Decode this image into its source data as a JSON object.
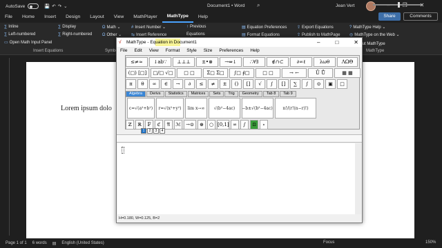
{
  "titlebar": {
    "autosave": "AutoSave",
    "autosave_state": "Off",
    "doc_title": "Document1 • Word",
    "user": "Jean Vert"
  },
  "tabs": [
    "File",
    "Home",
    "Insert",
    "Design",
    "Layout",
    "View",
    "MathPlayer",
    "MathType",
    "Help"
  ],
  "active_tab": "MathType",
  "share": "Share",
  "comments": "Comments",
  "ribbon": {
    "insert_equations": [
      "Inline",
      "Left-numbered",
      "Open Math Input Panel"
    ],
    "display": [
      "Display",
      "Right-numbered"
    ],
    "symbols": [
      "Math",
      "Other"
    ],
    "group_insert_equations": "Insert Equations",
    "group_symbols": "Symbo",
    "insert_number": "Insert Number",
    "insert_reference": "Insert Reference",
    "previous": "Previous",
    "equations": "Equations",
    "equation_prefs": "Equation Preferences",
    "format_equations": "Format Equations",
    "export_equations": "Export Equations",
    "publish_mathpage": "Publish to MathPage",
    "mathtype_help": "MathType Help",
    "mathtype_web": "MathType on the Web",
    "about": "About MathType",
    "group_mathtype": "MathType"
  },
  "document": {
    "text": "Lorem ipsum dolo"
  },
  "status": {
    "page": "Page 1 of 1",
    "words": "6 words",
    "language": "English (United States)",
    "focus": "Focus",
    "zoom": "150%"
  },
  "mathtype": {
    "title": "MathType - Equation in Document1",
    "menu": [
      "File",
      "Edit",
      "View",
      "Format",
      "Style",
      "Size",
      "Preferences",
      "Help"
    ],
    "row1": [
      "≤≠≈",
      "↓ab∵",
      "⊥⊥⊥",
      "±•⊗",
      "→⇔↓",
      "∴∀∃",
      "∉∩⊂",
      "∂∞ℓ",
      "λωθ",
      "ΛΩΘ"
    ],
    "row2": [
      "(□) [□]",
      "□/□ √□",
      "□ □",
      "Σ□ Σ□",
      "∫□ ∮□",
      "□ □",
      "→ ←",
      "Ū Ů",
      "▦ ▦"
    ],
    "row3": [
      "π",
      "θ",
      "∞",
      "∈",
      "→",
      "∂",
      "≤",
      "≠",
      "±",
      "()",
      "[]",
      "√",
      "∫",
      "[]",
      "∑",
      "∫",
      "⊙",
      "▣",
      "□"
    ],
    "tabs": [
      "Algebra",
      "Derivs",
      "Statistics",
      "Matrices",
      "Sets",
      "Trig",
      "Geometry",
      "Tab 8",
      "Tab 9"
    ],
    "active_tab": "Algebra",
    "templates": [
      "c=√(a²+b²)",
      "r=√(x²+y²)",
      "lim x→∞",
      "√(b²−4ac)",
      "x=(−b±√(b²−4ac))/2a",
      "n!/(r!(n−r)!)"
    ],
    "row5": [
      "ℤ",
      "ℝ",
      "𝔽",
      "ℭ",
      "𝔄",
      "ℳ",
      "→⊙",
      "⊕",
      "○",
      "[0,1]",
      "∞",
      "∫",
      "⊡",
      "∘"
    ],
    "sizes": [
      "1",
      "2",
      "3",
      "4"
    ],
    "status": "H=0.180, W=0.125, B=2"
  }
}
